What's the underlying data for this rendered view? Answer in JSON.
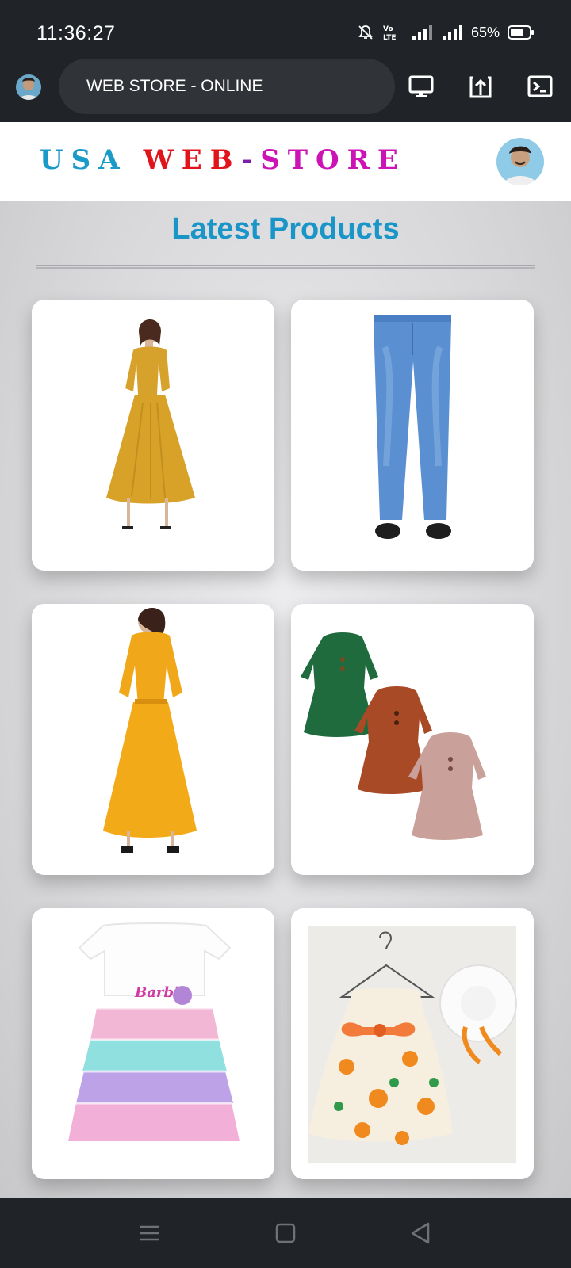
{
  "status": {
    "time": "11:36:27",
    "battery_text": "65%",
    "icons": [
      "mute-bell-icon",
      "volte-icon",
      "signal-icon",
      "signal-icon",
      "battery-icon"
    ]
  },
  "appbar": {
    "title": "WEB STORE - ONLINE",
    "icons": [
      "monitor-icon",
      "share-upload-icon",
      "terminal-icon"
    ]
  },
  "header": {
    "logo_usa": "USA",
    "logo_web": "WEB",
    "logo_dash": "-",
    "logo_store": "STORE"
  },
  "main": {
    "title": "Latest Products",
    "products": [
      {
        "image": "mustard-long-sleeve-dress"
      },
      {
        "image": "blue-denim-jeans"
      },
      {
        "image": "orange-midi-dress"
      },
      {
        "image": "girls-ruffle-dresses-set"
      },
      {
        "image": "barbie-rainbow-tutu-dress"
      },
      {
        "image": "floral-baby-dress-with-hat"
      }
    ]
  },
  "navbar": {
    "icons": [
      "menu-icon",
      "home-square-icon",
      "back-triangle-icon"
    ]
  },
  "colors": {
    "accent": "#1a95c8",
    "logo_red": "#e1131b",
    "logo_magenta": "#cc14b6",
    "bar_dark": "#202428"
  }
}
